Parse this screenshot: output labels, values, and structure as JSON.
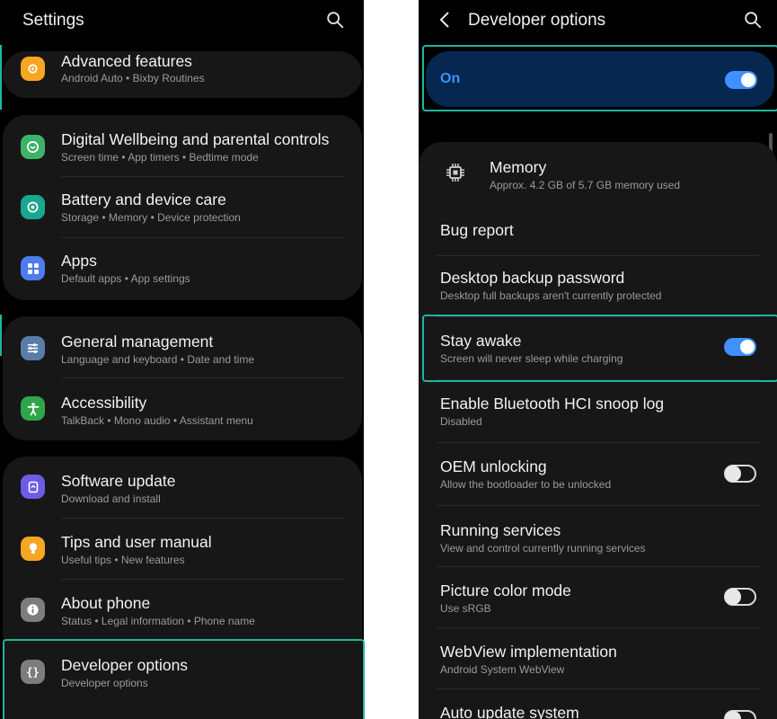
{
  "left": {
    "title": "Settings",
    "items": [
      {
        "title": "Advanced features",
        "subtitle": "Android Auto  •  Bixby Routines",
        "icon": "gear-plus-icon",
        "color": "#f5a623"
      },
      {
        "title": "Digital Wellbeing and parental controls",
        "subtitle": "Screen time  •  App timers  •  Bedtime mode",
        "icon": "wellbeing-icon",
        "color": "#3db36a"
      },
      {
        "title": "Battery and device care",
        "subtitle": "Storage  •  Memory  •  Device protection",
        "icon": "device-care-icon",
        "color": "#17a88f"
      },
      {
        "title": "Apps",
        "subtitle": "Default apps  •  App settings",
        "icon": "apps-grid-icon",
        "color": "#4d7cf0"
      },
      {
        "title": "General management",
        "subtitle": "Language and keyboard  •  Date and time",
        "icon": "sliders-icon",
        "color": "#5a7da8"
      },
      {
        "title": "Accessibility",
        "subtitle": "TalkBack  •  Mono audio  •  Assistant menu",
        "icon": "accessibility-icon",
        "color": "#2fa64a"
      },
      {
        "title": "Software update",
        "subtitle": "Download and install",
        "icon": "software-update-icon",
        "color": "#6b5ce8"
      },
      {
        "title": "Tips and user manual",
        "subtitle": "Useful tips  •  New features",
        "icon": "lightbulb-icon",
        "color": "#f5a623"
      },
      {
        "title": "About phone",
        "subtitle": "Status  •  Legal information  •  Phone name",
        "icon": "info-icon",
        "color": "#7d7d7d"
      },
      {
        "title": "Developer options",
        "subtitle": "Developer options",
        "icon": "developer-braces-icon",
        "color": "#7d7d7d"
      }
    ]
  },
  "right": {
    "title": "Developer options",
    "master_label": "On",
    "master_on": true,
    "items": [
      {
        "title": "Memory",
        "subtitle": "Approx. 4.2 GB of 5.7 GB memory used",
        "icon": "chip-icon"
      },
      {
        "title": "Bug report",
        "subtitle": ""
      },
      {
        "title": "Desktop backup password",
        "subtitle": "Desktop full backups aren't currently protected"
      },
      {
        "title": "Stay awake",
        "subtitle": "Screen will never sleep while charging",
        "toggle": true
      },
      {
        "title": "Enable Bluetooth HCI snoop log",
        "subtitle": "Disabled"
      },
      {
        "title": "OEM unlocking",
        "subtitle": "Allow the bootloader to be unlocked",
        "toggle": false
      },
      {
        "title": "Running services",
        "subtitle": "View and control currently running services"
      },
      {
        "title": "Picture color mode",
        "subtitle": "Use sRGB",
        "toggle": false
      },
      {
        "title": "WebView implementation",
        "subtitle": "Android System WebView"
      },
      {
        "title": "Auto update system",
        "subtitle": "",
        "toggle": false
      }
    ]
  },
  "colors": {
    "accent": "#3e91ff",
    "highlight": "#1fb5a0",
    "card": "#171717",
    "master_bg": "#062850"
  }
}
